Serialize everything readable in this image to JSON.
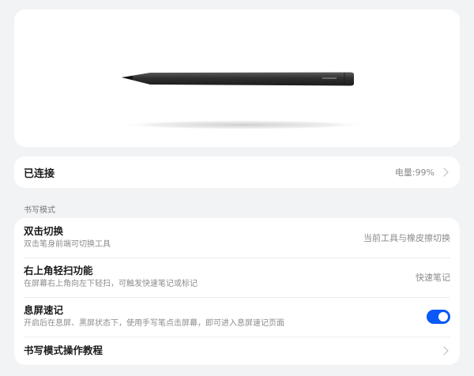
{
  "connection": {
    "label": "已连接",
    "battery": "电量:99%"
  },
  "section": {
    "title": "书写模式"
  },
  "settings": {
    "double_tap": {
      "title": "双击切换",
      "desc": "双击笔身前端可切换工具",
      "value": "当前工具与橡皮擦切换"
    },
    "corner_swipe": {
      "title": "右上角轻扫功能",
      "desc": "在屏幕右上角向左下轻扫，可触发快速笔记或标记",
      "value": "快速笔记"
    },
    "screen_off_memo": {
      "title": "息屏速记",
      "desc": "开启后在息屏、黑屏状态下，使用手写笔点击屏幕，即可进入息屏速记页面",
      "enabled": true
    },
    "tutorial": {
      "title": "书写模式操作教程"
    }
  },
  "colors": {
    "accent": "#0a59f7",
    "background": "#f1f3f5",
    "card": "#ffffff"
  }
}
